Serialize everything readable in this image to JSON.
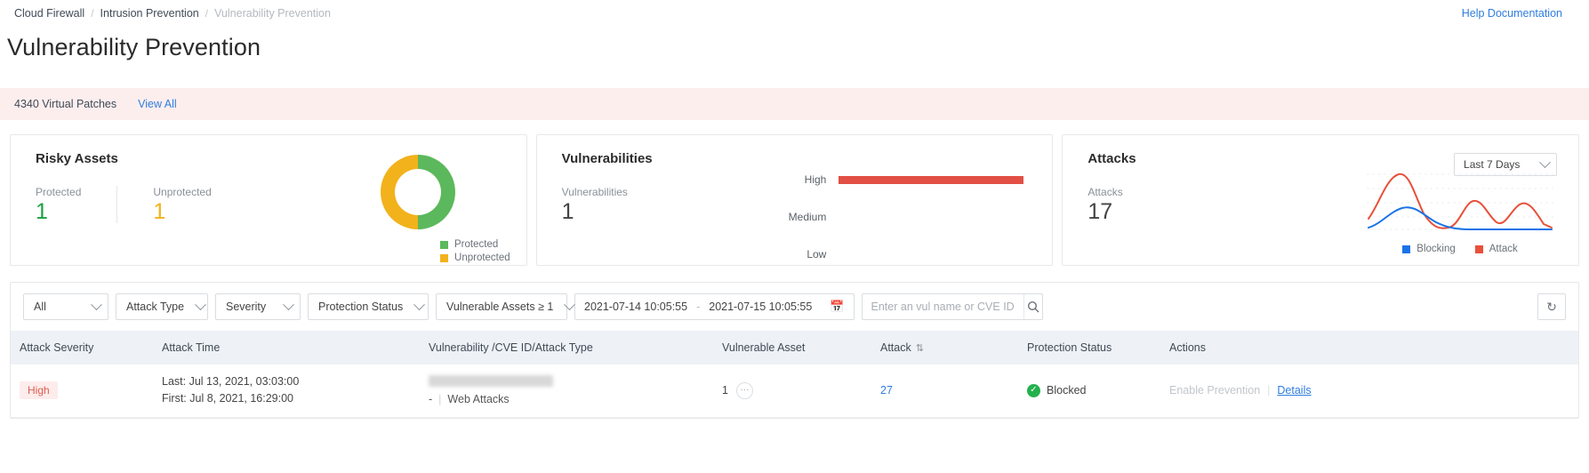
{
  "breadcrumb": {
    "items": [
      {
        "label": "Cloud Firewall",
        "muted": false
      },
      {
        "label": "Intrusion Prevention",
        "muted": false
      },
      {
        "label": "Vulnerability Prevention",
        "muted": true
      }
    ],
    "separator": "/",
    "help_link": "Help Documentation"
  },
  "page": {
    "title": "Vulnerability Prevention"
  },
  "patch_banner": {
    "text": "4340 Virtual Patches",
    "view_all": "View All",
    "background": "#fdeeee"
  },
  "cards": {
    "risky_assets": {
      "title": "Risky Assets",
      "metrics": [
        {
          "label": "Protected",
          "value": "1",
          "color": "#1aa141"
        },
        {
          "label": "Unprotected",
          "value": "1",
          "color": "#f2b21c"
        }
      ],
      "legend": [
        {
          "label": "Protected",
          "color": "#5cb85c"
        },
        {
          "label": "Unprotected",
          "color": "#f2b21c"
        }
      ]
    },
    "vulnerabilities": {
      "title": "Vulnerabilities",
      "metric_label": "Vulnerabilities",
      "metric_value": "1",
      "bars": [
        {
          "label": "High",
          "value": 1,
          "color": "#e14f45"
        },
        {
          "label": "Medium",
          "value": 0,
          "color": "#e14f45"
        },
        {
          "label": "Low",
          "value": 0,
          "color": "#e14f45"
        }
      ]
    },
    "attacks": {
      "title": "Attacks",
      "metric_label": "Attacks",
      "metric_value": "17",
      "range_selected": "Last 7 Days",
      "legend": [
        {
          "label": "Blocking",
          "color": "#1a73e8"
        },
        {
          "label": "Attack",
          "color": "#e8503a"
        }
      ]
    }
  },
  "chart_data": [
    {
      "type": "pie",
      "title": "Risky Assets",
      "labels": [
        "Protected",
        "Unprotected"
      ],
      "values": [
        1,
        1
      ],
      "colors": [
        "#5cb85c",
        "#f2b21c"
      ],
      "legend_position": "bottom-right",
      "donut": true
    },
    {
      "type": "bar",
      "title": "Vulnerabilities",
      "orientation": "horizontal",
      "categories": [
        "High",
        "Medium",
        "Low"
      ],
      "values": [
        1,
        0,
        0
      ],
      "colors": [
        "#e14f45",
        "#e14f45",
        "#e14f45"
      ],
      "xlabel": "",
      "ylabel": "",
      "xlim": [
        0,
        1
      ],
      "grid": false
    },
    {
      "type": "line",
      "title": "Attacks",
      "x": [
        1,
        2,
        3,
        4,
        5,
        6,
        7,
        8,
        9,
        10,
        11,
        12
      ],
      "series": [
        {
          "name": "Attack",
          "color": "#e8503a",
          "values": [
            0.22,
            0.72,
            0.92,
            0.6,
            0.16,
            0.14,
            0.52,
            0.3,
            0.6,
            0.26,
            0.46,
            0.12
          ]
        },
        {
          "name": "Blocking",
          "color": "#1a73e8",
          "values": [
            0.04,
            0.26,
            0.36,
            0.22,
            0.04,
            0.02,
            0.02,
            0.02,
            0.02,
            0.02,
            0.02,
            0.02
          ]
        }
      ],
      "legend_position": "bottom",
      "grid": true,
      "axes_visible": false
    }
  ],
  "toolbar": {
    "filters": [
      {
        "name": "all",
        "label": "All"
      },
      {
        "name": "attack-type",
        "label": "Attack Type"
      },
      {
        "name": "severity",
        "label": "Severity"
      },
      {
        "name": "protection-status",
        "label": "Protection Status"
      },
      {
        "name": "vulnerable-assets",
        "label": "Vulnerable Assets ≥ 1"
      }
    ],
    "date_start": "2021-07-14 10:05:55",
    "date_dash": "-",
    "date_end": "2021-07-15 10:05:55",
    "calendar_icon": "📅",
    "search_placeholder": "Enter an vul name or CVE ID",
    "search_value": "",
    "search_icon": "⚲",
    "refresh_icon": "↻"
  },
  "table": {
    "columns": [
      "Attack Severity",
      "Attack Time",
      "Vulnerability /CVE ID/Attack Type",
      "Vulnerable Asset",
      "Attack",
      "Protection Status",
      "Actions"
    ],
    "sort_column": "Attack",
    "sort_icon": "⇅",
    "rows": [
      {
        "severity": "High",
        "time_last": "Last: Jul 13, 2021, 03:03:00",
        "time_first": "First: Jul 8, 2021, 16:29:00",
        "vuln_name": "",
        "cve_id": "-",
        "attack_type": "Web Attacks",
        "vuln_separator": "|",
        "vulnerable_asset": "1",
        "asset_more": "···",
        "attack_count": "27",
        "protection_status": "Blocked",
        "protection_icon": "✓",
        "action_disabled": "Enable Prevention",
        "action_separator": "|",
        "action_link": "Details"
      }
    ]
  }
}
